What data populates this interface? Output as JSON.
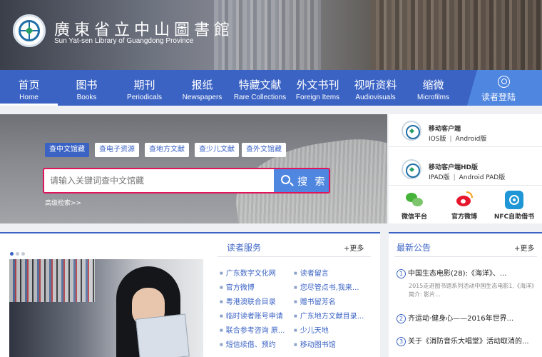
{
  "header": {
    "title": "廣東省立中山圖書館",
    "subtitle": "Sun Yat-sen Library of Guangdong Province"
  },
  "nav": {
    "items": [
      {
        "zh": "首页",
        "en": "Home"
      },
      {
        "zh": "图书",
        "en": "Books"
      },
      {
        "zh": "期刊",
        "en": "Periodicals"
      },
      {
        "zh": "报纸",
        "en": "Newspapers"
      },
      {
        "zh": "特藏文献",
        "en": "Rare Collections"
      },
      {
        "zh": "外文书刊",
        "en": "Foreign Items"
      },
      {
        "zh": "视听资料",
        "en": "Audiovisuals"
      },
      {
        "zh": "缩微",
        "en": "Microfilms"
      }
    ],
    "login_label": "读者登陆"
  },
  "search": {
    "tabs": [
      "查中文馆藏",
      "查电子资源",
      "查地方文献",
      "查少儿文献",
      "查外文馆藏"
    ],
    "placeholder": "请输入关键词查中文馆藏",
    "button_label": "搜 索",
    "advanced_link": "高级检索>>"
  },
  "apps": {
    "mobile_title": "移动客户端",
    "mobile_ios": "IOS版",
    "mobile_android": "Android版",
    "hd_title": "移动客户端HD版",
    "hd_ipad": "IPAD版",
    "hd_android": "Android PAD版",
    "separator": "|",
    "social": [
      "微信平台",
      "官方微博",
      "NFC自助借书"
    ]
  },
  "services": {
    "title": "读者服务",
    "more": "+更多",
    "left": [
      "广东数字文化网",
      "官方微博",
      "粤港澳联合目录",
      "临时读者账号申请",
      "联合参考咨询 原...",
      "短信续借、预约"
    ],
    "right": [
      "读者留言",
      "您尽管点书,我来...",
      "赠书留芳名",
      "广东地方文献目录...",
      "少儿天地",
      "移动图书馆"
    ]
  },
  "notices": {
    "title": "最新公告",
    "more": "+更多",
    "items": [
      {
        "num": "1",
        "text": "中国生态电影(28):《海洋》、...",
        "desc": "2015走进图书馆系列活动中国生态电影1,《海洋》简介: 影片..."
      },
      {
        "num": "2",
        "text": "齐运动·健身心——2016年世界..."
      },
      {
        "num": "3",
        "text": "关于《消防音乐大唱堂》活动取消的..."
      }
    ]
  },
  "colors": {
    "nav_blue": "#3b63c4",
    "accent_blue": "#4f86e0",
    "search_border": "#e0145a"
  }
}
